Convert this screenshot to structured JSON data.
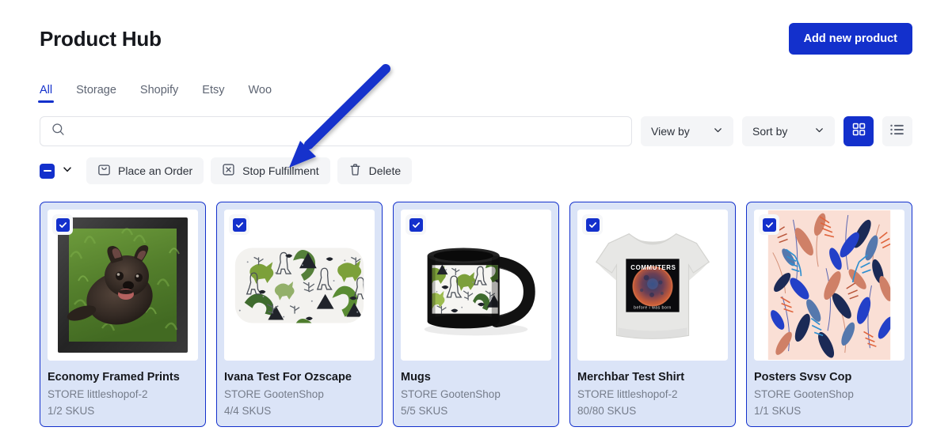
{
  "header": {
    "title": "Product Hub",
    "add_button_label": "Add new product"
  },
  "tabs": [
    {
      "label": "All",
      "active": true
    },
    {
      "label": "Storage",
      "active": false
    },
    {
      "label": "Shopify",
      "active": false
    },
    {
      "label": "Etsy",
      "active": false
    },
    {
      "label": "Woo",
      "active": false
    }
  ],
  "filters": {
    "search_placeholder": "",
    "search_value": "",
    "search_icon": "search-icon",
    "view_by_label": "View by",
    "sort_by_label": "Sort by",
    "chevron_icon": "chevron-down-icon",
    "grid_view_icon": "grid-view-icon",
    "list_view_icon": "list-view-icon",
    "grid_view_active": true
  },
  "bulk_actions": {
    "select_all_state": "indeterminate",
    "select_all_icon": "checkbox-indeterminate-icon",
    "select_all_caret_icon": "chevron-down-icon",
    "buttons": [
      {
        "label": "Place an Order",
        "icon": "bag-icon"
      },
      {
        "label": "Stop Fulfillment",
        "icon": "cancel-box-icon"
      },
      {
        "label": "Delete",
        "icon": "trash-icon"
      }
    ]
  },
  "products": [
    {
      "title": "Economy Framed Prints",
      "store": "STORE littleshopof-2",
      "skus": "1/2 SKUS",
      "selected": true,
      "art": "framed-dog-print"
    },
    {
      "title": "Ivana Test For Ozscape",
      "store": "STORE GootenShop",
      "skus": "4/4 SKUS",
      "selected": true,
      "art": "dino-blanket"
    },
    {
      "title": "Mugs",
      "store": "STORE GootenShop",
      "skus": "5/5 SKUS",
      "selected": true,
      "art": "dino-mug"
    },
    {
      "title": "Merchbar Test Shirt",
      "store": "STORE littleshopof-2",
      "skus": "80/80 SKUS",
      "selected": true,
      "art": "commuters-tshirt"
    },
    {
      "title": "Posters Svsv Cop",
      "store": "STORE GootenShop",
      "skus": "1/1 SKUS",
      "selected": true,
      "art": "botanical-poster"
    }
  ],
  "annotation": {
    "type": "arrow",
    "color": "#1330cc",
    "points_to": "Stop Fulfillment"
  },
  "colors": {
    "accent": "#1330cc",
    "card_selected_bg": "#dbe4f7",
    "chip_bg": "#f4f5f7",
    "muted_text": "#757c8a"
  }
}
